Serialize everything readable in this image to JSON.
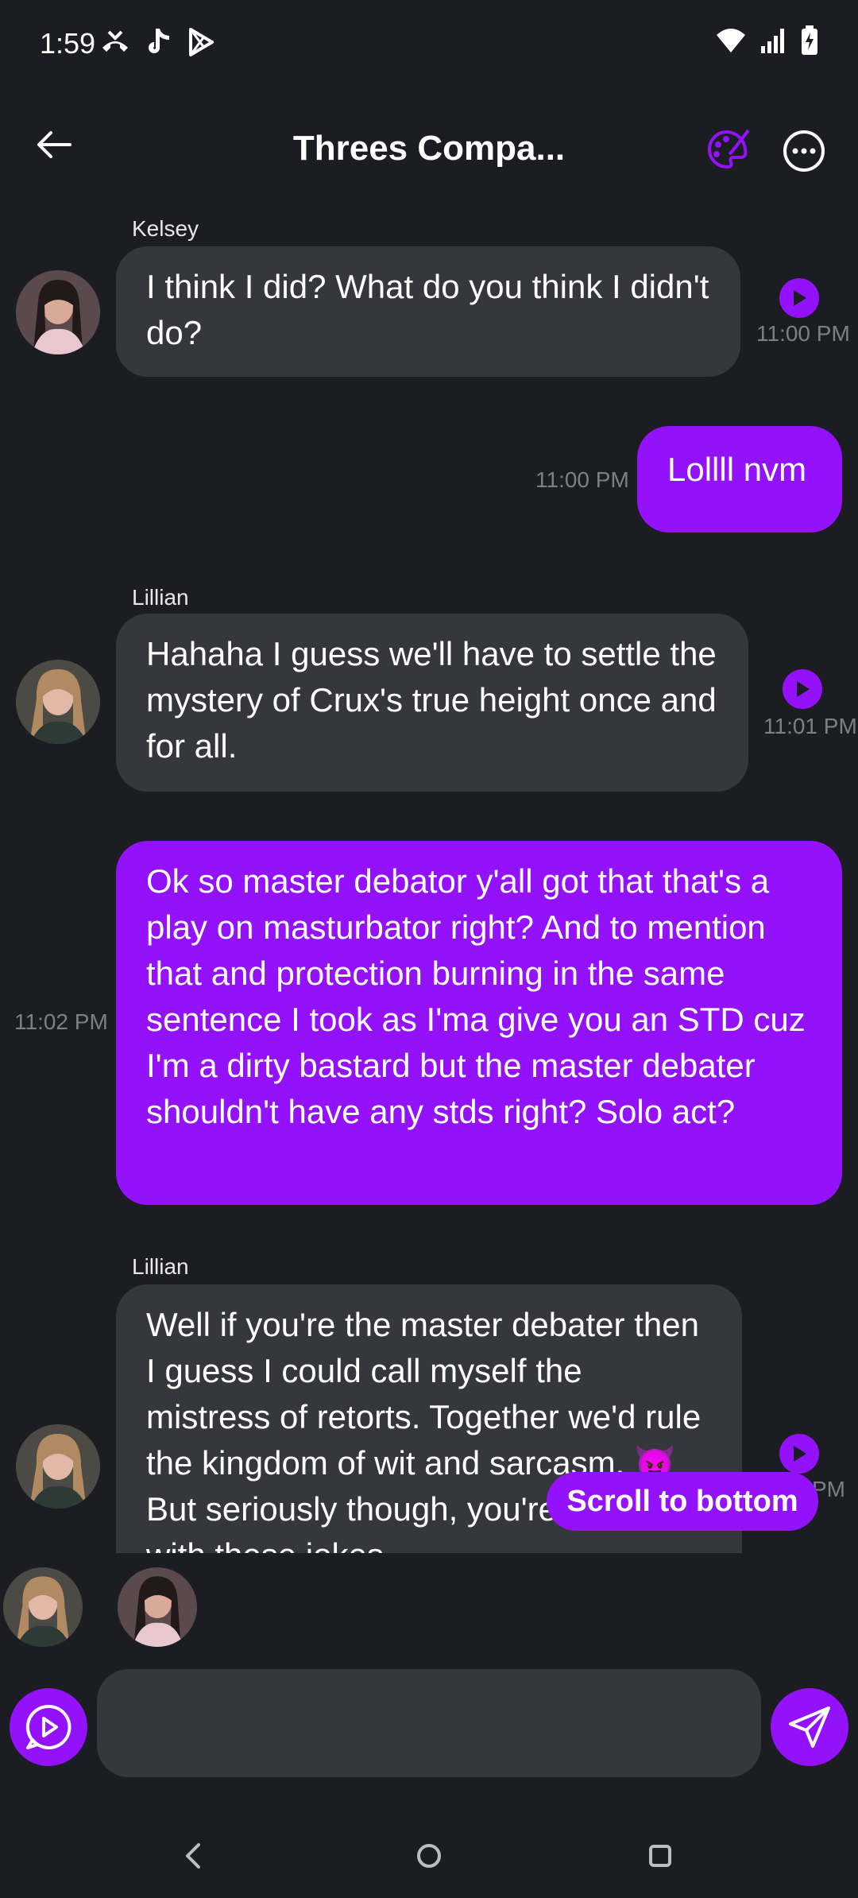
{
  "status_bar": {
    "time": "1:59"
  },
  "header": {
    "title": "Threes Compa..."
  },
  "messages": [
    {
      "sender": "Kelsey",
      "text": "I think I did? What do you think I didn't do?",
      "time": "11:00 PM"
    },
    {
      "text": "Lollll nvm",
      "time": "11:00 PM"
    },
    {
      "sender": "Lillian",
      "text": "Hahaha I guess we'll have to settle the mystery of Crux's true height once and for all.",
      "time": "11:01 PM"
    },
    {
      "text": "Ok so master debator y'all got that that's a play on masturbator right? And to mention that and protection burning in the same sentence I took as I'ma give you an STD cuz I'm a dirty bastard but the master debater shouldn't have any stds right? Solo act?",
      "time": "11:02 PM"
    },
    {
      "sender": "Lillian",
      "text": "Well if you're the master debater then I guess I could call myself the mistress of retorts. Together we'd rule the kingdom of wit and sarcasm. 😈 But seriously though, you're killing me with these jokes",
      "time": "PM"
    }
  ],
  "scroll_to_bottom_label": "Scroll to bottom",
  "composer": {
    "placeholder": ""
  },
  "colors": {
    "accent": "#9312fb",
    "background": "#1c1d22",
    "bubble_in": "#35373d"
  }
}
